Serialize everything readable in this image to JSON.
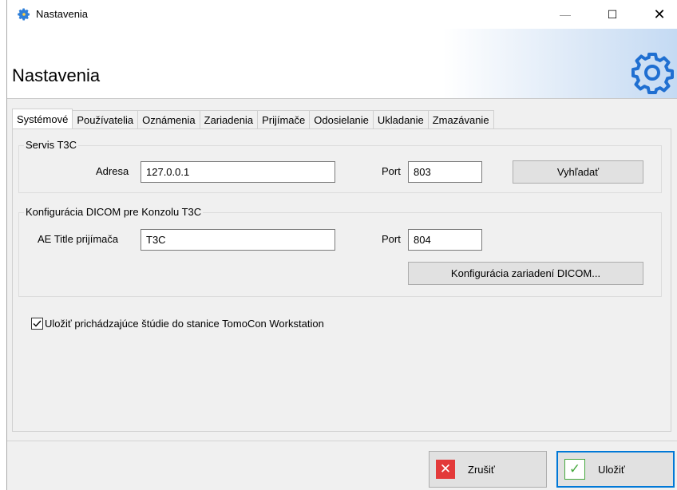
{
  "window": {
    "title": "Nastavenia",
    "min_glyph": "—",
    "max_glyph": "☐",
    "close_glyph": "✕"
  },
  "header": {
    "title": "Nastavenia",
    "icon": "gear-icon"
  },
  "tabs": [
    {
      "label": "Systémové",
      "active": true
    },
    {
      "label": "Používatelia"
    },
    {
      "label": "Oznámenia"
    },
    {
      "label": "Zariadenia"
    },
    {
      "label": "Prijímače"
    },
    {
      "label": "Odosielanie"
    },
    {
      "label": "Ukladanie"
    },
    {
      "label": "Zmazávanie"
    }
  ],
  "service": {
    "legend": "Servis T3C",
    "address_label": "Adresa",
    "address_value": "127.0.0.1",
    "port_label": "Port",
    "port_value": "803",
    "search_button": "Vyhľadať"
  },
  "dicom": {
    "legend": "Konfigurácia DICOM pre Konzolu T3C",
    "ae_label": "AE Title prijímača",
    "ae_value": "T3C",
    "port_label": "Port",
    "port_value": "804",
    "config_button": "Konfigurácia zariadení DICOM..."
  },
  "checkbox": {
    "label": "Uložiť prichádzajúce štúdie do stanice TomoCon Workstation",
    "checked": true
  },
  "footer": {
    "cancel_label": "Zrušiť",
    "cancel_glyph": "✕",
    "save_label": "Uložiť",
    "save_glyph": "✓"
  },
  "colors": {
    "cancel_icon_bg": "#e33a3a",
    "save_icon_check": "#46a83d",
    "save_button_border": "#0078d7",
    "gear_blue": "#1f6fd1"
  }
}
